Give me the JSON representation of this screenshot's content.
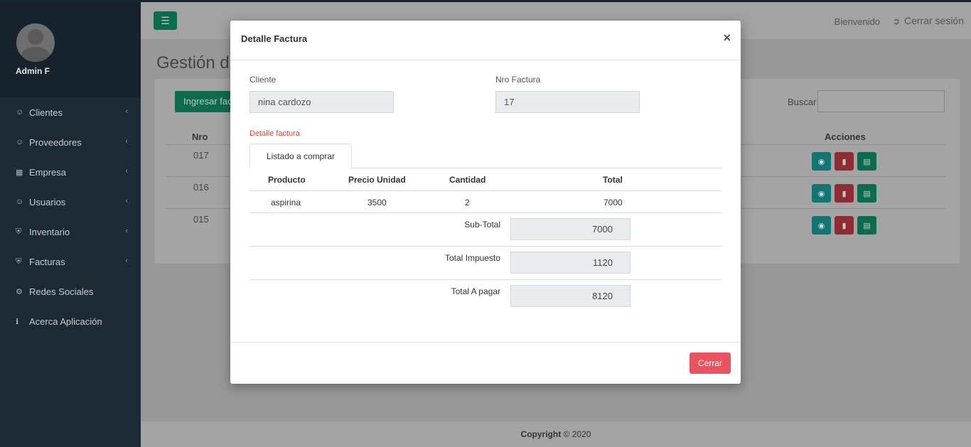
{
  "sidebar": {
    "user_name": "Admin F",
    "items": [
      {
        "label": "Clientes",
        "icon": "user-icon",
        "has_children": true
      },
      {
        "label": "Proveedores",
        "icon": "user-icon",
        "has_children": true
      },
      {
        "label": "Empresa",
        "icon": "building-icon",
        "has_children": true
      },
      {
        "label": "Usuarios",
        "icon": "user-icon",
        "has_children": true
      },
      {
        "label": "Inventario",
        "icon": "cart-icon",
        "has_children": true
      },
      {
        "label": "Facturas",
        "icon": "cart-icon",
        "has_children": true
      },
      {
        "label": "Redes Sociales",
        "icon": "gear-icon",
        "has_children": false
      },
      {
        "label": "Acerca Aplicación",
        "icon": "info-icon",
        "has_children": false
      }
    ]
  },
  "topbar": {
    "welcome": "Bienvenido",
    "logout": "Cerrar sesión"
  },
  "page": {
    "title_visible": "Gestión de",
    "add_button_visible": "Ingresar fac",
    "search_label": "Buscar",
    "search_value": "",
    "columns": {
      "nro": "Nro",
      "acciones": "Acciones"
    },
    "rows": [
      {
        "nro": "017"
      },
      {
        "nro": "016"
      },
      {
        "nro": "015"
      }
    ]
  },
  "footer": {
    "copyright_bold": "Copyright",
    "copyright_rest": "© 2020"
  },
  "modal": {
    "title": "Detalle Factura",
    "close_symbol": "×",
    "cliente_label": "Cliente",
    "cliente_value": "nina cardozo",
    "nro_label": "Nro Factura",
    "nro_value": "17",
    "section_label": "Detalle factura",
    "tab_label": "Listado a comprar",
    "columns": {
      "producto": "Producto",
      "precio": "Precio Unidad",
      "cantidad": "Cantidad",
      "total": "Total"
    },
    "items": [
      {
        "producto": "aspirina",
        "precio": "3500",
        "cantidad": "2",
        "total": "7000"
      }
    ],
    "subtotal_label": "Sub-Total",
    "subtotal_value": "7000",
    "impuesto_label": "Total Impuesto",
    "impuesto_value": "1120",
    "total_label": "Total A pagar",
    "total_value": "8120",
    "close_button": "Cerrar"
  },
  "colors": {
    "sidebar_bg": "#1c2a35",
    "accent_green": "#0c6b4f",
    "danger": "#eb5361",
    "section_red": "#d9432e"
  }
}
